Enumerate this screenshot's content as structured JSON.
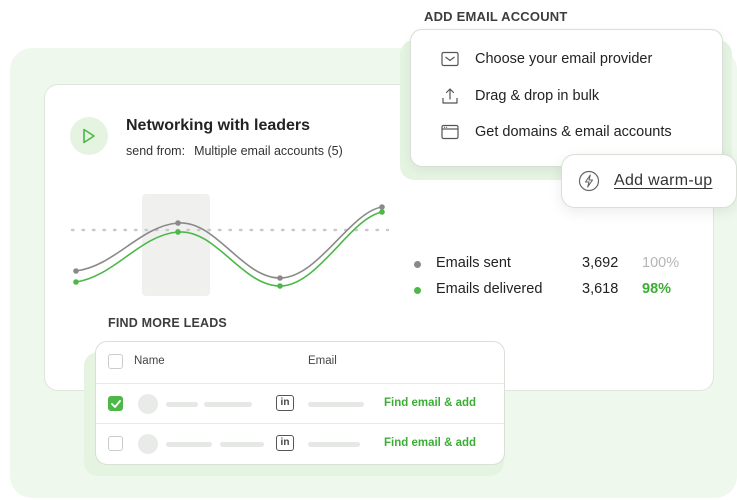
{
  "campaign": {
    "title": "Networking with leaders",
    "send_from_label": "send from:",
    "send_from_value": "Multiple email accounts (5)"
  },
  "stats": [
    {
      "name": "Emails sent",
      "value": "3,692",
      "percent": "100%",
      "dot_color": "#8a8a8a",
      "percent_color": "#b5b5b5"
    },
    {
      "name": "Emails delivered",
      "value": "3,618",
      "percent": "98%",
      "dot_color": "#4cb848",
      "percent_color": "#3cae35"
    }
  ],
  "email_account": {
    "heading": "ADD EMAIL ACCOUNT",
    "options": [
      {
        "label": "Choose your email provider",
        "icon": "envelope-icon"
      },
      {
        "label": "Drag & drop in bulk",
        "icon": "upload-icon"
      },
      {
        "label": "Get domains & email accounts",
        "icon": "browser-window-icon"
      }
    ]
  },
  "warmup": {
    "label": "Add warm-up",
    "icon": "lightning-icon"
  },
  "leads": {
    "heading": "FIND MORE LEADS",
    "columns": {
      "name": "Name",
      "email": "Email"
    },
    "rows": [
      {
        "checked": true,
        "action": "Find email & add",
        "icon": "linkedin-icon"
      },
      {
        "checked": false,
        "action": "Find email & add",
        "icon": "linkedin-icon"
      }
    ]
  },
  "colors": {
    "accent": "#4cb848",
    "panel_bg": "#eef8ec",
    "sent_line": "#8a8a8a",
    "delivered_line": "#4cb848"
  }
}
